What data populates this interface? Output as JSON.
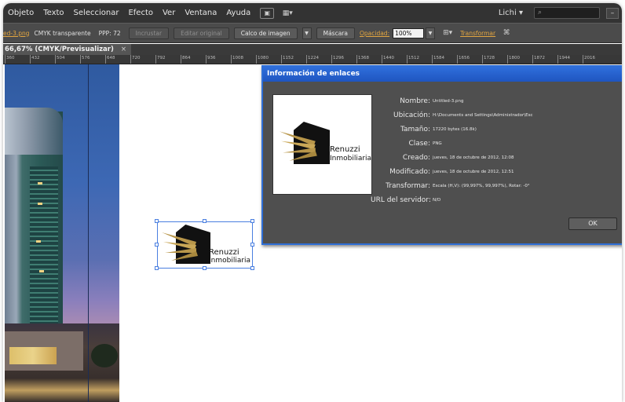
{
  "menubar": {
    "items": [
      "Objeto",
      "Texto",
      "Seleccionar",
      "Efecto",
      "Ver",
      "Ventana",
      "Ayuda"
    ],
    "workspace": "Lichi",
    "search_placeholder": ""
  },
  "controlbar": {
    "file_name": "ed-3.png",
    "mode": "CMYK transparente",
    "ppp": "PPP: 72",
    "incrustar": "Incrustar",
    "editar_original": "Editar original",
    "calco": "Calco de imagen",
    "mascara": "Máscara",
    "opacidad_label": "Opacidad:",
    "opacidad_value": "100%",
    "transformar": "Transformar"
  },
  "doc_tab": {
    "title": "66,67% (CMYK/Previsualizar)",
    "close": "×"
  },
  "ruler": {
    "labels": [
      "360",
      "432",
      "504",
      "576",
      "648",
      "720",
      "792",
      "864",
      "936",
      "1008",
      "1080",
      "1152",
      "1224",
      "1296",
      "1368",
      "1440",
      "1512",
      "1584",
      "1656",
      "1728",
      "1800",
      "1872",
      "1944",
      "2016"
    ]
  },
  "placed_logo": {
    "line1": "Renuzzi",
    "line2": "Inmobiliaria"
  },
  "dialog": {
    "title": "Información de enlaces",
    "thumb_line1": "Renuzzi",
    "thumb_line2": "Inmobiliaria",
    "fields": [
      {
        "label": "Nombre:",
        "value": "Untitled-3.png"
      },
      {
        "label": "Ubicación:",
        "value": "H:\\Documents and Settings\\Administrador\\Esc"
      },
      {
        "label": "Tamaño:",
        "value": "17220 bytes (16.8k)"
      },
      {
        "label": "Clase:",
        "value": "PNG"
      },
      {
        "label": "Creado:",
        "value": "jueves, 18 de octubre de 2012, 12:08"
      },
      {
        "label": "Modificado:",
        "value": "jueves, 18 de octubre de 2012, 12:51"
      },
      {
        "label": "Transformar:",
        "value": "Escala (H,V): (99,997%, 99,997%), Rotar: -0°"
      },
      {
        "label": "URL del servidor:",
        "value": "N/D"
      }
    ],
    "ok": "OK"
  }
}
